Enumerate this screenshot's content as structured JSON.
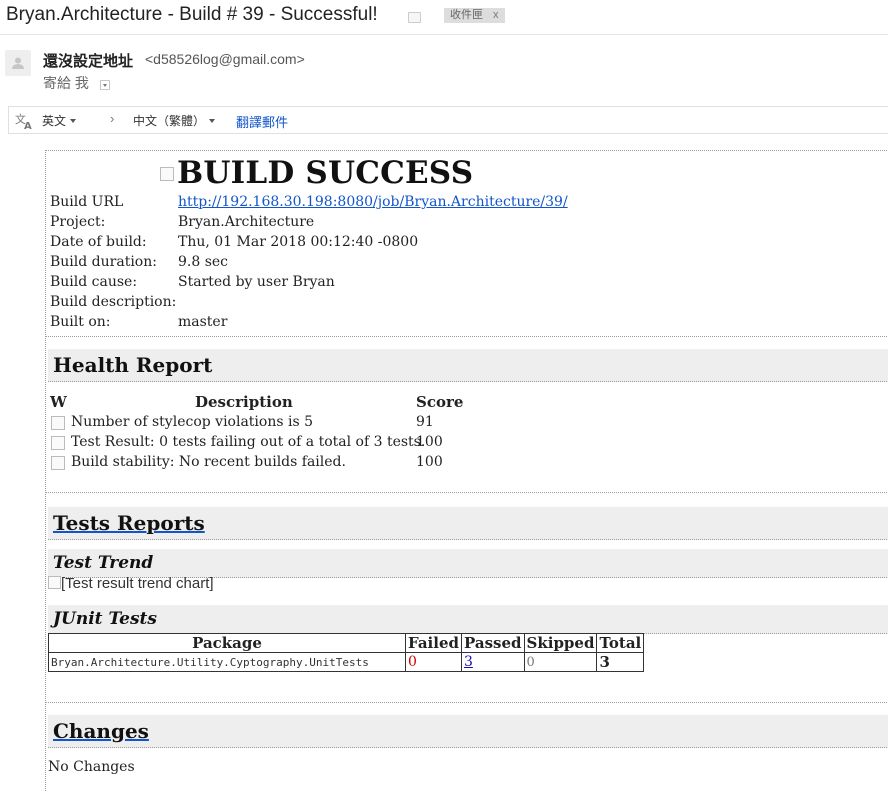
{
  "email": {
    "subject": "Bryan.Architecture - Build # 39 - Successful!",
    "label": "收件匣",
    "label_remove": "x",
    "sender_name": "還沒設定地址",
    "sender_email": "<d58526log@gmail.com>",
    "to": "寄給 我"
  },
  "translate": {
    "source_lang": "英文",
    "arrow": "›",
    "target_lang": "中文（繁體）",
    "action": "翻譯郵件"
  },
  "report": {
    "title": "BUILD SUCCESS",
    "fields": [
      {
        "label": "Build URL",
        "value": "http://192.168.30.198:8080/job/Bryan.Architecture/39/"
      },
      {
        "label": "Project:",
        "value": "Bryan.Architecture"
      },
      {
        "label": "Date of build:",
        "value": "Thu, 01 Mar 2018 00:12:40 -0800"
      },
      {
        "label": "Build duration:",
        "value": "9.8 sec"
      },
      {
        "label": "Build cause:",
        "value": "Started by user Bryan"
      },
      {
        "label": "Build description:",
        "value": ""
      },
      {
        "label": "Built on:",
        "value": "master"
      }
    ],
    "health": {
      "heading": "Health Report",
      "columns": [
        "W",
        "Description",
        "Score"
      ],
      "rows": [
        {
          "description": "Number of stylecop violations is 5",
          "score": "91"
        },
        {
          "description": "Test Result: 0 tests failing out of a total of 3 tests.",
          "score": "100"
        },
        {
          "description": "Build stability: No recent builds failed.",
          "score": "100"
        }
      ]
    },
    "tests": {
      "heading": "Tests Reports",
      "trend_heading": "Test Trend",
      "trend_alt": "[Test result trend chart]",
      "junit_heading": "JUnit Tests",
      "columns": [
        "Package",
        "Failed",
        "Passed",
        "Skipped",
        "Total"
      ],
      "rows": [
        {
          "package": "Bryan.Architecture.Utility.Cyptography.UnitTests",
          "failed": "0",
          "passed": "3",
          "skipped": "0",
          "total": "3"
        }
      ]
    },
    "changes": {
      "heading": "Changes",
      "text": "No Changes"
    }
  }
}
